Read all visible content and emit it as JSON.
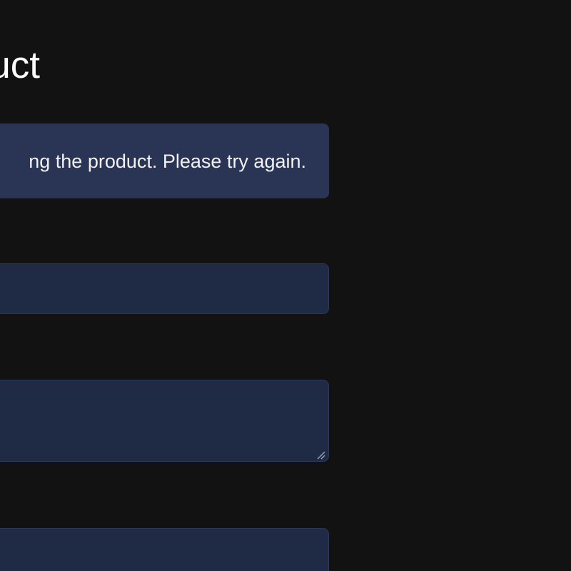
{
  "header": {
    "title": "uct"
  },
  "alert": {
    "message": "ng the product. Please try again."
  },
  "form": {
    "field1_value": "",
    "field2_value": "",
    "field3_value": ""
  },
  "colors": {
    "background": "#121212",
    "alert_bg": "#2a3454",
    "input_bg": "#1f2a45",
    "text": "#ffffff"
  },
  "icons": {
    "resize_handle": "resize-grip-icon"
  }
}
